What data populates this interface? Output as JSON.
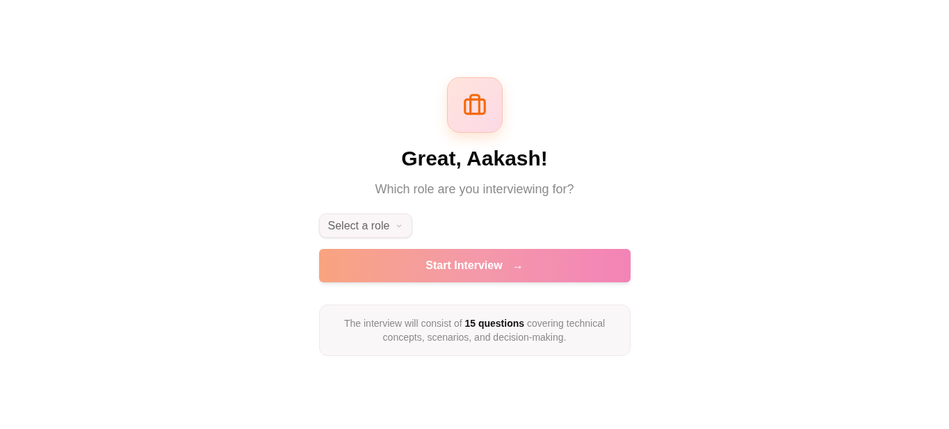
{
  "heading": "Great, Aakash!",
  "subtitle": "Which role are you interviewing for?",
  "role_select": {
    "placeholder": "Select a role"
  },
  "start_button": {
    "label": "Start Interview",
    "icon": "→",
    "disabled": true
  },
  "info": "The interview will consist of **15 questions** covering technical concepts, scenarios, and decision-making."
}
